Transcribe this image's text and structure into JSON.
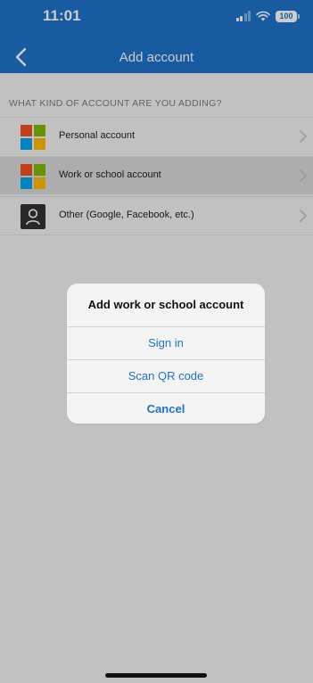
{
  "status_bar": {
    "time": "11:01",
    "battery": "100"
  },
  "nav": {
    "title": "Add account",
    "back_icon": "chevron-left-icon"
  },
  "list": {
    "section_header": "WHAT KIND OF ACCOUNT ARE YOU ADDING?",
    "items": [
      {
        "label": "Personal account",
        "icon": "microsoft-logo-icon",
        "selected": false
      },
      {
        "label": "Work or school account",
        "icon": "microsoft-logo-icon",
        "selected": true
      },
      {
        "label": "Other (Google, Facebook, etc.)",
        "icon": "person-icon",
        "selected": false
      }
    ]
  },
  "alert": {
    "title": "Add work or school account",
    "sign_in": "Sign in",
    "scan_qr": "Scan QR code",
    "cancel": "Cancel"
  },
  "colors": {
    "accent": "#1e72c8",
    "background": "#f2f2f2",
    "selected_row": "#d9d9d9"
  }
}
